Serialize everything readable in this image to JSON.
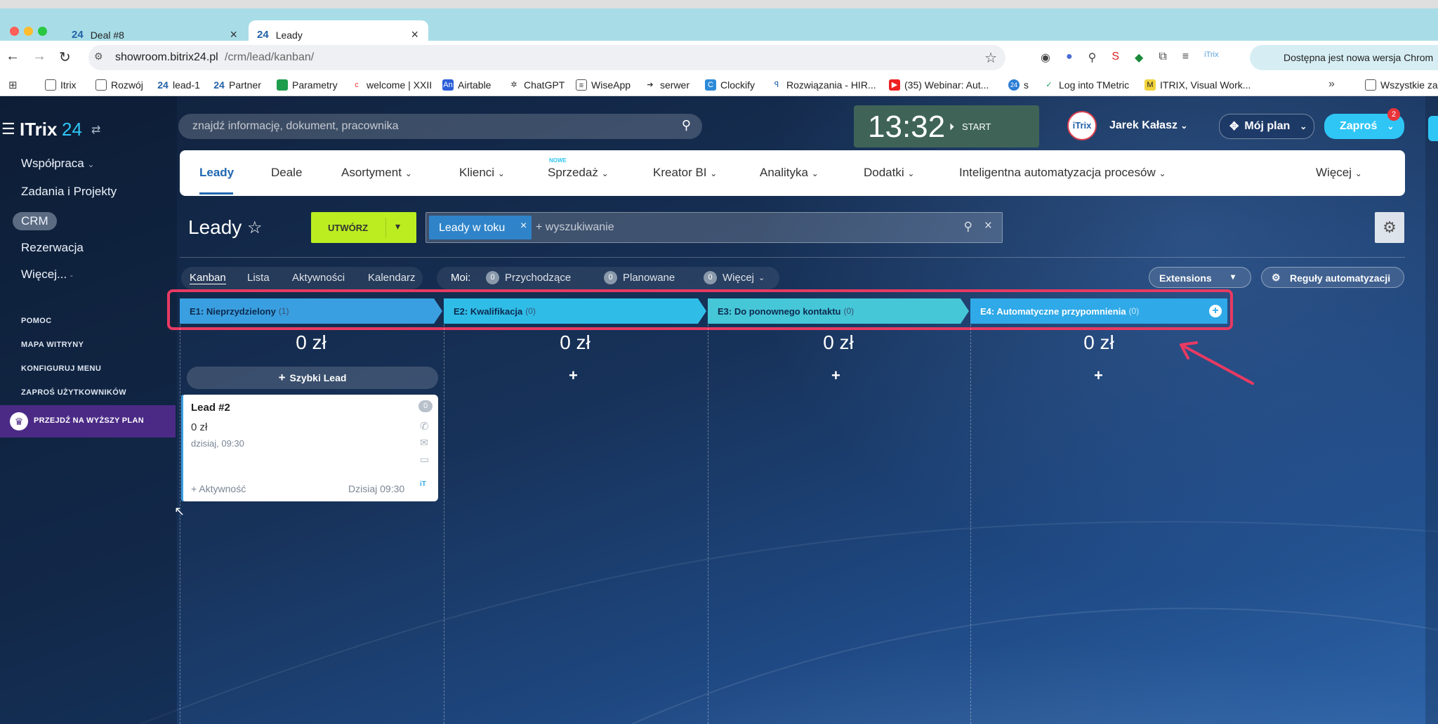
{
  "browser": {
    "tabs": [
      {
        "label": "Deal #8",
        "active": false
      },
      {
        "label": "Leady",
        "active": true
      }
    ],
    "url_host": "showroom.bitrix24.pl",
    "url_path": "/crm/lead/kanban/",
    "update_notice": "Dostępna jest nowa wersja Chrom",
    "bookmarks": [
      "Itrix",
      "Rozwój",
      "lead-1",
      "Partner",
      "Parametry",
      "welcome | XXII",
      "Airtable",
      "ChatGPT",
      "WiseApp",
      "serwer",
      "Clockify",
      "Rozwiązania - HIR...",
      "(35) Webinar: Aut...",
      "s",
      "Log into TMetric",
      "ITRIX, Visual Work...",
      "Wszystkie za"
    ],
    "bookmarks_overflow": "»"
  },
  "header": {
    "logo_main": "ITrix",
    "logo_num": "24",
    "search_placeholder": "znajdź informację, dokument, pracownika",
    "clock": "13:32",
    "clock_start": "START",
    "user_name": "Jarek Kałasz",
    "my_plan": "Mój plan",
    "invite": "Zaproś",
    "invite_badge": "2"
  },
  "sidebar": {
    "items": [
      "Współpraca",
      "Zadania i Projekty",
      "CRM",
      "Rezerwacja",
      "Więcej..."
    ],
    "small_links": [
      "POMOC",
      "MAPA WITRYNY",
      "KONFIGURUJ MENU",
      "ZAPROŚ UŻYTKOWNIKÓW"
    ],
    "upgrade": "PRZEJDŹ NA WYŻSZY PLAN"
  },
  "nav": {
    "items": [
      "Leady",
      "Deale",
      "Asortyment",
      "Klienci",
      "Sprzedaż",
      "Kreator BI",
      "Analityka",
      "Dodatki",
      "Inteligentna automatyzacja procesów"
    ],
    "new_label": "NOWE",
    "more": "Więcej"
  },
  "page": {
    "title": "Leady",
    "create_button": "UTWÓRZ",
    "filter_chip": "Leady w toku",
    "search_placeholder": "+ wyszukiwanie",
    "views": [
      "Kanban",
      "Lista",
      "Aktywności",
      "Kalendarz"
    ],
    "moi_label": "Moi:",
    "counters": [
      {
        "count": "0",
        "label": "Przychodzące"
      },
      {
        "count": "0",
        "label": "Planowane"
      },
      {
        "count": "0",
        "label": "Więcej"
      }
    ],
    "extensions": "Extensions",
    "automation_rules": "Reguły automatyzacji"
  },
  "kanban": {
    "stages": [
      {
        "title": "E1: Nieprzydzielony",
        "count": "(1)",
        "sum": "0 zł",
        "color": "#3a9fe0"
      },
      {
        "title": "E2: Kwalifikacja",
        "count": "(0)",
        "sum": "0 zł",
        "color": "#2fbde8"
      },
      {
        "title": "E3: Do ponownego kontaktu",
        "count": "(0)",
        "sum": "0 zł",
        "color": "#46c7d8"
      },
      {
        "title": "E4: Automatyczne przypomnienia",
        "count": "(0)",
        "sum": "0 zł",
        "color": "#2fa9e8"
      }
    ],
    "quick_lead": "Szybki Lead",
    "card": {
      "title": "Lead #2",
      "badge": "0",
      "amount": "0 zł",
      "date": "dzisiaj, 09:30",
      "activity": "+ Aktywność",
      "footer_time": "Dzisiaj 09:30"
    }
  }
}
